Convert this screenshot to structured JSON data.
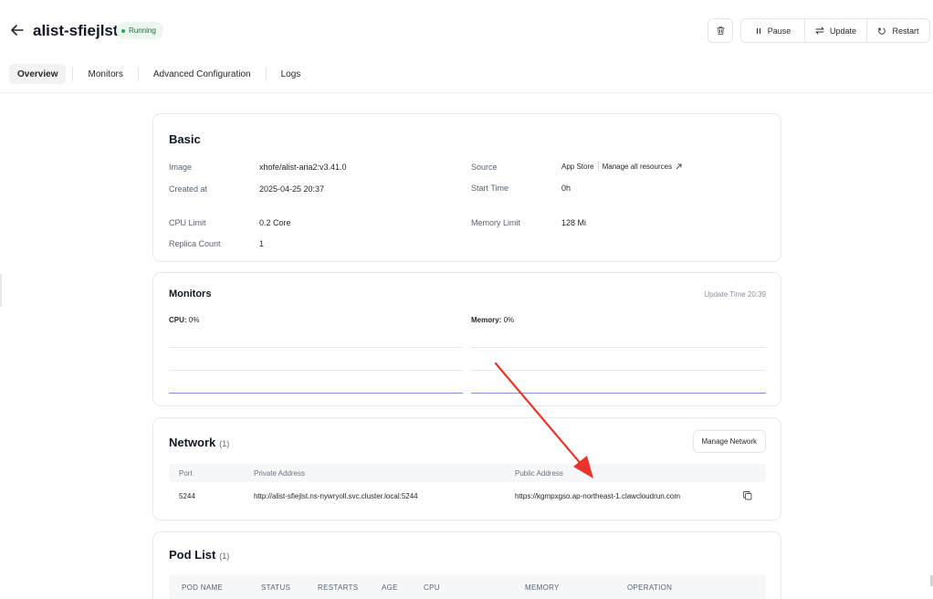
{
  "header": {
    "app_name": "alist-sfiejlst",
    "status": "Running",
    "buttons": {
      "pause": "Pause",
      "update": "Update",
      "restart": "Restart"
    }
  },
  "tabs": [
    {
      "label": "Overview",
      "active": true
    },
    {
      "label": "Monitors"
    },
    {
      "label": "Advanced Configuration"
    },
    {
      "label": "Logs"
    }
  ],
  "basic": {
    "title": "Basic",
    "image_label": "Image",
    "image_value": "xhofe/alist-aria2:v3.41.0",
    "created_label": "Created at",
    "created_value": "2025-04-25 20:37",
    "cpu_label": "CPU Limit",
    "cpu_value": "0.2 Core",
    "replica_label": "Replica Count",
    "replica_value": "1",
    "source_label": "Source",
    "source_value": "App Store",
    "manage_all": "Manage all resources",
    "start_label": "Start Time",
    "start_value": "0h",
    "memory_label": "Memory Limit",
    "memory_value": "128 Mi"
  },
  "monitors": {
    "title": "Monitors",
    "update_label": "Update Time",
    "update_time": "20:39",
    "cpu_label": "CPU:",
    "cpu_value": "0%",
    "memory_label": "Memory:",
    "memory_value": "0%"
  },
  "network": {
    "title": "Network",
    "count": "(1)",
    "manage_button": "Manage Network",
    "columns": {
      "port": "Port",
      "private": "Private Address",
      "public": "Public Address"
    },
    "rows": [
      {
        "port": "5244",
        "private": "http://alist-sfiejlst.ns-nywryoll.svc.cluster.local:5244",
        "public": "https://kgmpxgso.ap-northeast-1.clawcloudrun.com"
      }
    ]
  },
  "pods": {
    "title": "Pod List",
    "count": "(1)",
    "columns": [
      "POD NAME",
      "STATUS",
      "RESTARTS",
      "AGE",
      "CPU",
      "MEMORY",
      "OPERATION"
    ]
  },
  "colors": {
    "running_dot": "#22a855",
    "annotation_arrow": "#e8342a",
    "chart_line": "#7b98d6"
  }
}
